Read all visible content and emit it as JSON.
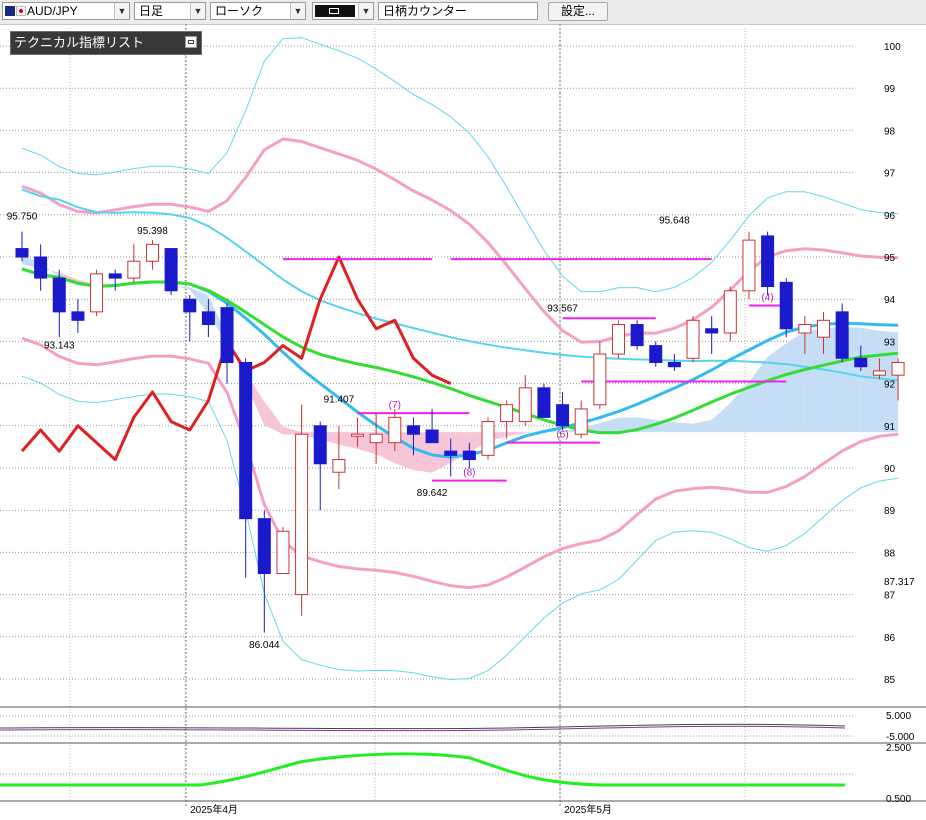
{
  "toolbar": {
    "symbol": "AUD/JPY",
    "timeframe": "日足",
    "chart_type": "ローソク",
    "symbol_counter": "日柄カウンター",
    "settings_label": "設定..."
  },
  "indicator_panel": {
    "title": "テクニカル指標リスト"
  },
  "colors": {
    "up_candle": "#cc3333",
    "down_candle": "#1a1acc",
    "cloud_bear": "#f7c5d8",
    "cloud_bull": "#c6def5",
    "kijun": "#33dd33",
    "ma_long": "#55d4ee",
    "ma_mid": "#33bbee",
    "bollinger_2": "#f4a0c6",
    "bollinger_3": "#66d6ee",
    "rci": "#e02020",
    "level_line": "#ee22ee"
  },
  "chart_data": {
    "type": "candlestick",
    "ylim": [
      84.5,
      100.5
    ],
    "y_ticks": [
      "100",
      "99",
      "98",
      "97",
      "96",
      "95",
      "94",
      "93",
      "92",
      "91",
      "90",
      "89",
      "88",
      "87",
      "86",
      "85"
    ],
    "extra_price_label": "87.317",
    "date_labels": [
      {
        "bar": 0,
        "label": ""
      },
      {
        "bar": 7,
        "label": "2025年4月"
      },
      {
        "bar": 26,
        "label": "2025年5月"
      }
    ],
    "candles": [
      [
        95.2,
        95.6,
        94.9,
        95.0
      ],
      [
        95.0,
        95.3,
        94.2,
        94.5
      ],
      [
        94.5,
        94.7,
        93.1,
        93.7
      ],
      [
        93.7,
        94.0,
        93.2,
        93.5
      ],
      [
        93.7,
        94.7,
        93.6,
        94.6
      ],
      [
        94.6,
        94.7,
        94.2,
        94.5
      ],
      [
        94.5,
        95.3,
        94.4,
        94.9
      ],
      [
        94.9,
        95.4,
        94.7,
        95.3
      ],
      [
        95.2,
        95.2,
        94.1,
        94.2
      ],
      [
        94.0,
        94.1,
        93.0,
        93.7
      ],
      [
        93.7,
        94.0,
        93.1,
        93.4
      ],
      [
        93.8,
        93.9,
        92.0,
        92.5
      ],
      [
        92.5,
        92.6,
        87.4,
        88.8
      ],
      [
        88.8,
        89.0,
        86.1,
        87.5
      ],
      [
        87.5,
        88.6,
        87.5,
        88.5
      ],
      [
        87.0,
        91.5,
        86.5,
        90.8
      ],
      [
        91.0,
        91.1,
        89.0,
        90.1
      ],
      [
        89.9,
        91.0,
        89.5,
        90.2
      ],
      [
        90.8,
        91.2,
        90.5,
        90.8
      ],
      [
        90.6,
        91.3,
        90.1,
        90.8
      ],
      [
        90.6,
        91.4,
        90.4,
        91.2
      ],
      [
        91.0,
        91.2,
        90.3,
        90.8
      ],
      [
        90.9,
        91.4,
        90.6,
        90.6
      ],
      [
        90.4,
        90.7,
        89.8,
        90.3
      ],
      [
        90.4,
        90.6,
        90.0,
        90.2
      ],
      [
        90.3,
        91.2,
        90.2,
        91.1
      ],
      [
        91.1,
        91.6,
        90.7,
        91.5
      ],
      [
        91.1,
        92.2,
        91.0,
        91.9
      ],
      [
        91.9,
        92.0,
        91.4,
        91.2
      ],
      [
        91.5,
        91.8,
        90.9,
        91.0
      ],
      [
        90.8,
        91.6,
        90.7,
        91.4
      ],
      [
        91.5,
        93.0,
        91.4,
        92.7
      ],
      [
        92.7,
        93.5,
        92.6,
        93.4
      ],
      [
        93.4,
        93.5,
        92.8,
        92.9
      ],
      [
        92.9,
        93.0,
        92.4,
        92.5
      ],
      [
        92.5,
        92.7,
        92.3,
        92.4
      ],
      [
        92.6,
        93.6,
        92.5,
        93.5
      ],
      [
        93.3,
        93.6,
        92.7,
        93.2
      ],
      [
        93.2,
        94.3,
        93.0,
        94.2
      ],
      [
        94.2,
        95.6,
        94.0,
        95.4
      ],
      [
        95.5,
        95.6,
        94.1,
        94.3
      ],
      [
        94.4,
        94.5,
        93.1,
        93.3
      ],
      [
        93.2,
        93.6,
        92.7,
        93.4
      ],
      [
        93.1,
        93.7,
        92.7,
        93.5
      ],
      [
        93.7,
        93.9,
        92.5,
        92.6
      ],
      [
        92.6,
        92.9,
        92.3,
        92.4
      ],
      [
        92.2,
        92.6,
        92.1,
        92.3
      ],
      [
        92.2,
        92.6,
        91.6,
        92.5
      ]
    ],
    "annotations": [
      {
        "text": "95.750",
        "bar": 0,
        "price": 95.75,
        "pos": "above"
      },
      {
        "text": "95.398",
        "bar": 7,
        "price": 95.4,
        "pos": "above"
      },
      {
        "text": "93.143",
        "bar": 2,
        "price": 93.14,
        "pos": "below"
      },
      {
        "text": "86.044",
        "bar": 13,
        "price": 86.04,
        "pos": "below"
      },
      {
        "text": "91.407",
        "bar": 17,
        "price": 91.41,
        "pos": "above"
      },
      {
        "text": "89.642",
        "bar": 22,
        "price": 89.64,
        "pos": "below"
      },
      {
        "text": "93.567",
        "bar": 29,
        "price": 93.57,
        "pos": "above"
      },
      {
        "text": "95.648",
        "bar": 35,
        "price": 95.65,
        "pos": "above"
      }
    ],
    "level_marks": [
      {
        "label": "(7)",
        "price": 91.3,
        "from": 18,
        "to": 24,
        "label_bar": 20
      },
      {
        "label": "(8)",
        "price": 89.7,
        "from": 22,
        "to": 26,
        "label_bar": 24
      },
      {
        "label": "(6)",
        "price": 90.6,
        "from": 26,
        "to": 31,
        "label_bar": 29
      },
      {
        "label": "(4)",
        "price": 93.85,
        "from": 39,
        "to": 41,
        "label_bar": 40
      }
    ],
    "extra_levels": [
      {
        "price": 94.95,
        "from": 14,
        "to": 22
      },
      {
        "price": 94.95,
        "from": 23,
        "to": 37
      },
      {
        "price": 93.55,
        "from": 29,
        "to": 34
      },
      {
        "price": 92.05,
        "from": 30,
        "to": 41
      }
    ],
    "rci_points": [
      [
        0,
        90.4
      ],
      [
        1,
        90.9
      ],
      [
        2,
        90.4
      ],
      [
        3,
        91.0
      ],
      [
        4,
        90.6
      ],
      [
        5,
        90.2
      ],
      [
        6,
        91.2
      ],
      [
        7,
        91.8
      ],
      [
        8,
        91.1
      ],
      [
        9,
        90.9
      ],
      [
        10,
        91.6
      ],
      [
        11,
        93.0
      ],
      [
        12,
        92.3
      ],
      [
        13,
        92.5
      ],
      [
        14,
        92.9
      ],
      [
        15,
        92.6
      ],
      [
        16,
        94.0
      ],
      [
        17,
        95.0
      ],
      [
        18,
        94.0
      ],
      [
        19,
        93.3
      ],
      [
        20,
        93.5
      ],
      [
        21,
        92.6
      ],
      [
        22,
        92.2
      ],
      [
        23,
        92.0
      ]
    ],
    "sub_ticks": [
      "5.000",
      "-5.000"
    ],
    "sub2_ticks": [
      "2.500",
      "0.500"
    ]
  }
}
